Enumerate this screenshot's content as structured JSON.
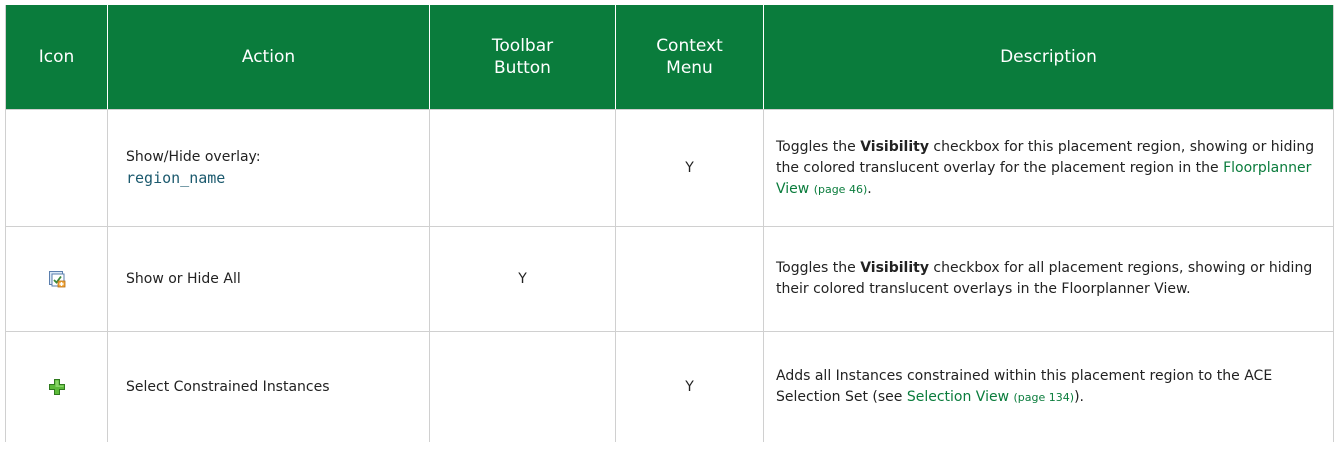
{
  "table": {
    "headers": {
      "icon": "Icon",
      "action": "Action",
      "toolbar_button": "Toolbar Button",
      "context_menu": "Context Menu",
      "description": "Description"
    },
    "rows": [
      {
        "icon": "",
        "action_prefix": "Show/Hide overlay:",
        "action_code": "region_name",
        "toolbar_button": "",
        "context_menu": "Y",
        "desc_1": "Toggles the ",
        "desc_bold": "Visibility",
        "desc_2": " checkbox for this placement region, showing or hiding the colored translucent overlay for the placement region in the ",
        "desc_link": "Floorplanner View",
        "desc_page": "(page 46)",
        "desc_3": "."
      },
      {
        "icon": "visibility-toggle-icon",
        "action": "Show or Hide All",
        "toolbar_button": "Y",
        "context_menu": "",
        "desc_1": "Toggles the ",
        "desc_bold": "Visibility",
        "desc_2": " checkbox for all placement regions, showing or hiding their colored translucent overlays in the Floorplanner View."
      },
      {
        "icon": "green-plus-icon",
        "action": "Select Constrained Instances",
        "toolbar_button": "",
        "context_menu": "Y",
        "desc_1": "Adds all Instances constrained within this placement region to the ACE Selection Set (see ",
        "desc_link": "Selection View",
        "desc_page": "(page 134)",
        "desc_2": ")."
      }
    ]
  },
  "colors": {
    "header_bg": "#0a7c3c",
    "link": "#0a7c3c",
    "code": "#1c5a6e"
  }
}
